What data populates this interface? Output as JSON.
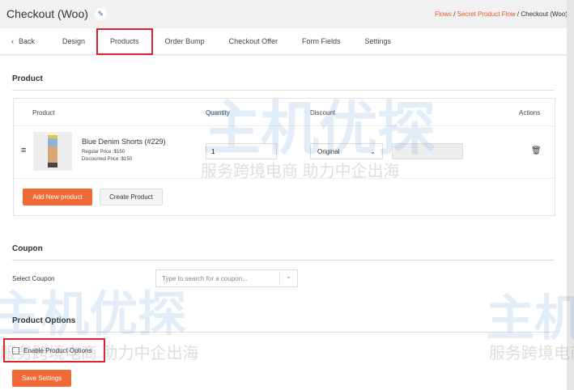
{
  "header": {
    "title": "Checkout (Woo)",
    "breadcrumb": {
      "flows": "Flows",
      "flow": "Secret Product Flow",
      "sep": " / ",
      "current": "Checkout (Woo)"
    }
  },
  "tabs": [
    {
      "label": "Back"
    },
    {
      "label": "Design"
    },
    {
      "label": "Products"
    },
    {
      "label": "Order Bump"
    },
    {
      "label": "Checkout Offer"
    },
    {
      "label": "Form Fields"
    },
    {
      "label": "Settings"
    }
  ],
  "product": {
    "heading": "Product",
    "columns": {
      "product": "Product",
      "quantity": "Quantity",
      "discount": "Discount",
      "actions": "Actions"
    },
    "row": {
      "name": "Blue Denim Shorts (#229)",
      "regular": "Regular Price :$150",
      "discounted": "Discounted Price :$150",
      "quantity": "1",
      "discount_type": "Original"
    },
    "add_button": "Add New product",
    "create_button": "Create Product"
  },
  "coupon": {
    "heading": "Coupon",
    "label": "Select Coupon",
    "placeholder": "Type to search for a coupon..."
  },
  "options": {
    "heading": "Product Options",
    "checkbox_label": "Enable Product Options"
  },
  "save_button": "Save Settings",
  "watermark": {
    "logo": "主机优探",
    "slogan": "服务跨境电商 助力中企出海"
  },
  "colors": {
    "accent": "#f06a35",
    "highlight": "#d9232f",
    "link": "#e05a2b"
  }
}
